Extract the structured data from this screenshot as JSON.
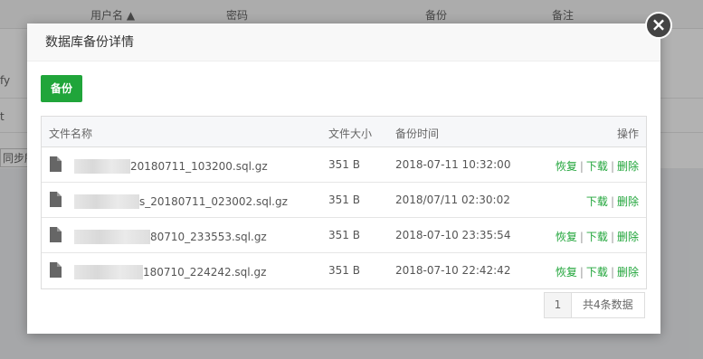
{
  "background": {
    "columns": [
      "用户名 ▲",
      "密码",
      "备份",
      "备注"
    ],
    "row_fragments": [
      "fy",
      "t",
      "同步所"
    ]
  },
  "modal": {
    "title": "数据库备份详情",
    "close_glyph": "×",
    "backup_button": "备份",
    "table": {
      "headers": {
        "name": "文件名称",
        "size": "文件大小",
        "time": "备份时间",
        "ops": "操作"
      },
      "rows": [
        {
          "name": "20180711_103200.sql.gz",
          "size": "351 B",
          "time": "2018-07-11 10:32:00",
          "ops": [
            "恢复",
            "下载",
            "删除"
          ]
        },
        {
          "name": "s_20180711_023002.sql.gz",
          "size": "351 B",
          "time": "2018/07/11 02:30:02",
          "ops": [
            "下载",
            "删除"
          ]
        },
        {
          "name": "80710_233553.sql.gz",
          "size": "351 B",
          "time": "2018-07-10 23:35:54",
          "ops": [
            "恢复",
            "下载",
            "删除"
          ]
        },
        {
          "name": "180710_224242.sql.gz",
          "size": "351 B",
          "time": "2018-07-10 22:42:42",
          "ops": [
            "恢复",
            "下载",
            "删除"
          ]
        }
      ]
    },
    "pagination": {
      "current": "1",
      "total_label": "共4条数据"
    }
  },
  "colors": {
    "accent": "#20a53a"
  }
}
